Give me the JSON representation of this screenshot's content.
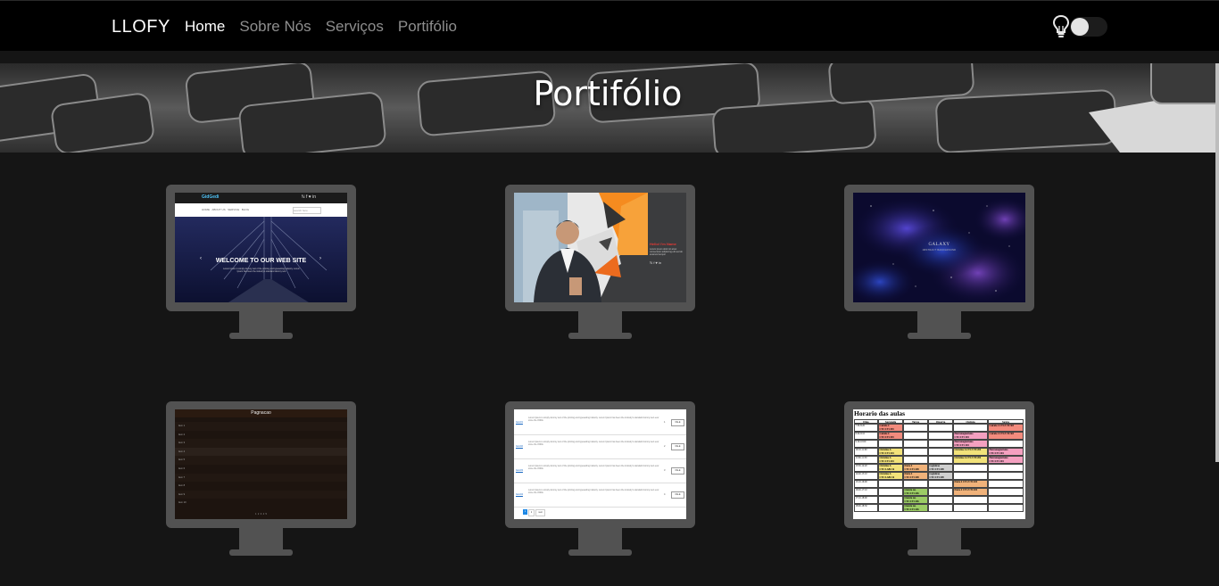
{
  "navbar": {
    "brand": "LLOFY",
    "links": [
      {
        "label": "Home",
        "active": true
      },
      {
        "label": "Sobre Nós",
        "active": false
      },
      {
        "label": "Serviços",
        "active": false
      },
      {
        "label": "Portifólio",
        "active": false
      }
    ],
    "theme_icon": "lightbulb-icon",
    "theme_toggle_on": false
  },
  "hero": {
    "title": "Portifólio"
  },
  "projects": [
    {
      "name": "bridge-website",
      "logo": "GidGedi",
      "menu": "HOME   ABOUT US   SERVICE   BLOG",
      "search": "search here",
      "headline": "WELCOME TO OUR WEB SITE",
      "body": "Lorem Ipsum is simply dummy text of the printing and typesetting industry. Lorem Ipsum has been the industry's standard dummy text"
    },
    {
      "name": "personal-portfolio",
      "hello": "Hello! I'm Name",
      "body": "Lorem ipsum dolor sit amet consectetur adipiscing elit sed do eiusmod tempor"
    },
    {
      "name": "galaxy-background",
      "title": "GALAXY",
      "subtitle": "ABSTRACT BACKGROUND"
    },
    {
      "name": "pagination-list",
      "title": "Pagnacao",
      "items": [
        "item 1",
        "item 2",
        "item 3",
        "item 4",
        "item 5",
        "item 6",
        "item 7",
        "item 8",
        "item 9",
        "item 10"
      ],
      "pager": "1  2  3  4  5"
    },
    {
      "name": "content-table",
      "rows": [
        {
          "link": "Item01",
          "text": "Lorem Ipsum is simply dummy text of the printing and typesetting industry. Lorem Ipsum has been the industry's standard dummy text ever since the 1500s",
          "num": "1",
          "btn": "FALE"
        },
        {
          "link": "Item02",
          "text": "Lorem Ipsum is simply dummy text of the printing and typesetting industry. Lorem Ipsum has been the industry's standard dummy text ever since the 1500s",
          "num": "2",
          "btn": "FALE"
        },
        {
          "link": "Item03",
          "text": "Lorem Ipsum is simply dummy text of the printing and typesetting industry. Lorem Ipsum has been the industry's standard dummy text ever since the 1500s",
          "num": "3",
          "btn": "FALE"
        },
        {
          "link": "Item04",
          "text": "Lorem Ipsum is simply dummy text of the printing and typesetting industry. Lorem Ipsum has been the industry's standard dummy text ever since the 1500s",
          "num": "4",
          "btn": "FALE"
        }
      ],
      "pager": [
        "1",
        "2",
        "next"
      ]
    },
    {
      "name": "class-schedule",
      "title": "Horario das aulas",
      "headers": [
        "Dias",
        "Segunda",
        "Terça",
        "Quarta",
        "Quinta",
        "Sexta"
      ],
      "rows": [
        [
          "7:30-8:20",
          "Calculo 4 CTC/CTC303",
          "",
          "",
          "",
          "Calculo 4 CTC/CTC303"
        ],
        [
          "8:20-9:10",
          "Calculo 4 CTC/CTC303",
          "",
          "",
          "Eletromagnetismo CTC/CTC104",
          "Calculo 4 CTC/CTC303"
        ],
        [
          "9:10-10:00",
          "",
          "",
          "",
          "Eletromagnetismo CTC/CTC104",
          ""
        ],
        [
          "10:10-11:00",
          "Circuitos A CTC/CTC204",
          "",
          "",
          "Circuitos A CTC/CTC204",
          "Eletromagnetismo CTC/CTC104"
        ],
        [
          "11:00-11:50",
          "Circuitos A CTC/CTC204",
          "",
          "",
          "Circuitos A CTC/CTC204",
          "Eletromagnetismo CTC/CTC104"
        ],
        [
          "13:30-14:20",
          "Circuitos A CTC/LABC16",
          "Fisica 4 CTC/CTC208",
          "Logisticas CTC/CTC208",
          "",
          ""
        ],
        [
          "14:20-15:10",
          "Circuitos A CTC/LABC16",
          "Fisica 4 CTC/CTC208",
          "Logisticas CTC/CTC208",
          "",
          ""
        ],
        [
          "15:10-16:00",
          "",
          "",
          "",
          "Fisica 4 CTC/CTC204",
          ""
        ],
        [
          "16:20-17:10",
          "",
          "Ciencia tec. CTC/CTC206",
          "",
          "Fisica 4 CTC/CTC204",
          ""
        ],
        [
          "17:10-18:00",
          "",
          "Ciencia tec. CTC/CTC206",
          "",
          "",
          ""
        ],
        [
          "18:00-18:50",
          "",
          "Ciencia tec. CTC/CTC206",
          "",
          "",
          ""
        ]
      ]
    }
  ],
  "colors": {
    "page_bg": "#151515",
    "navbar_bg": "#000000",
    "monitor_frame": "#525252",
    "nav_inactive": "#8e8e8e",
    "nav_active": "#ffffff"
  }
}
